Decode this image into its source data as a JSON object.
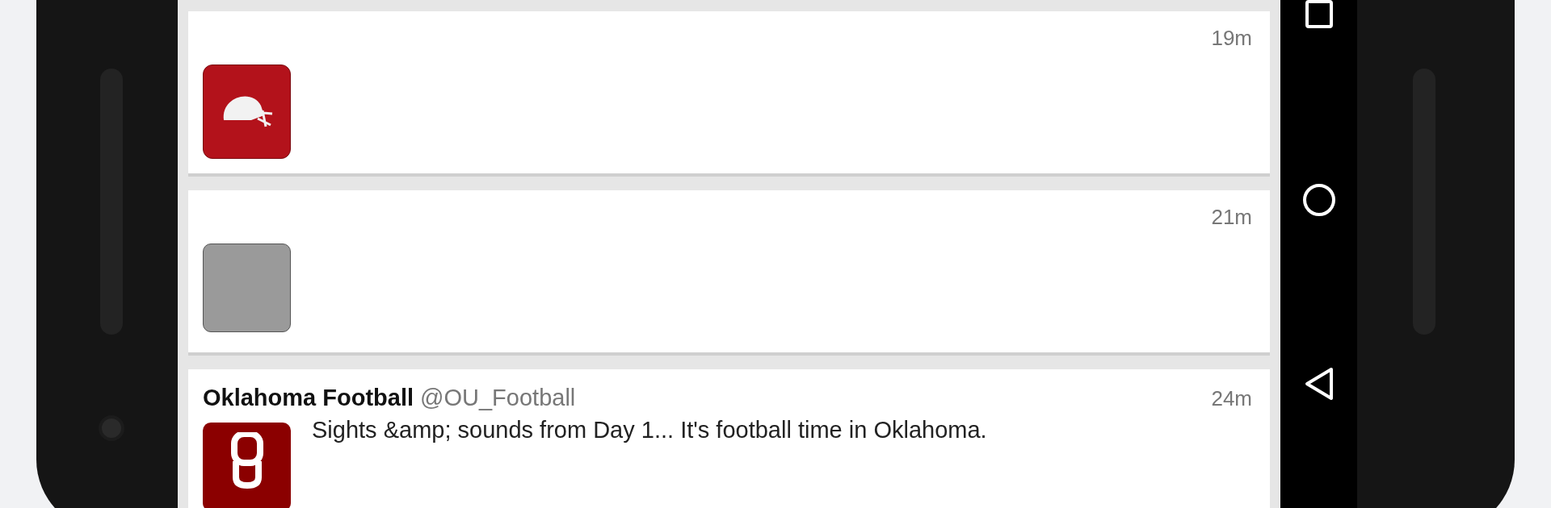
{
  "tweets": [
    {
      "kind": "app-logo",
      "time": "19m"
    },
    {
      "kind": "photo",
      "time": "21m"
    },
    {
      "kind": "team-logo",
      "name": "Oklahoma Football",
      "handle": "@OU_Football",
      "time": "24m",
      "text": "Sights &amp; sounds from Day 1... It's football time in Oklahoma."
    }
  ]
}
